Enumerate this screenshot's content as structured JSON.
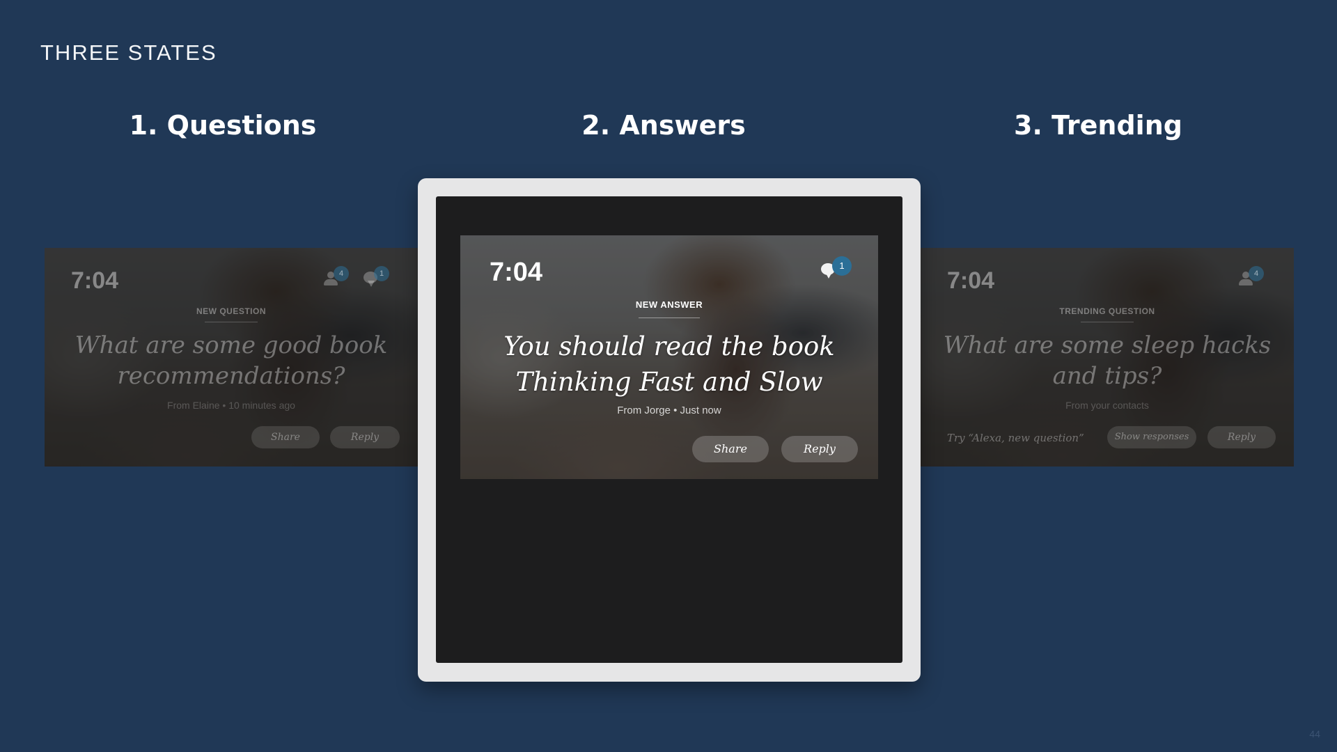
{
  "slide": {
    "title": "THREE STATES",
    "page_number": "44"
  },
  "headings": {
    "questions": "1. Questions",
    "answers": "2. Answers",
    "trending": "3. Trending"
  },
  "screens": {
    "questions": {
      "clock": "7:04",
      "contacts_badge": "4",
      "messages_badge": "1",
      "kicker": "NEW QUESTION",
      "text": "What are some good book recommendations?",
      "meta": "From Elaine • 10 minutes ago",
      "share_label": "Share",
      "reply_label": "Reply"
    },
    "answers": {
      "clock": "7:04",
      "messages_badge": "1",
      "kicker": "NEW ANSWER",
      "text": "You should read the book Thinking Fast and Slow",
      "meta": "From Jorge • Just now",
      "share_label": "Share",
      "reply_label": "Reply"
    },
    "trending": {
      "clock": "7:04",
      "contacts_badge": "4",
      "kicker": "TRENDING QUESTION",
      "text": "What are some sleep hacks and tips?",
      "meta": "From your contacts",
      "hint": "Try “Alexa, new question”",
      "show_responses_label": "Show responses",
      "reply_label": "Reply"
    }
  },
  "icons": {
    "contacts": "person-icon",
    "messages": "speech-bubble-icon"
  },
  "colors": {
    "background": "#203856",
    "badge": "#2b6f97",
    "device_frame": "#e6e6e7",
    "device_screen": "#1d1d1e"
  }
}
